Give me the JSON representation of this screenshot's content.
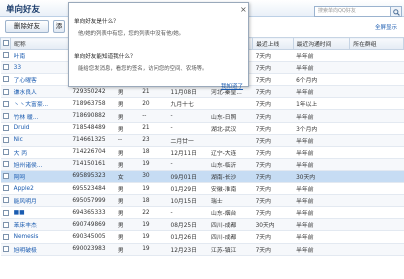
{
  "header": {
    "title": "单向好友",
    "search_placeholder": "搜索单向QQ好友",
    "search_icon": "magnifier"
  },
  "toolbar": {
    "delete_label": "删除好友",
    "filter_label": "添",
    "select_all": "全屏显示"
  },
  "popup": {
    "q1": "单向好友是什么？",
    "a1": "他/她的列表中有您，您的列表中没有他/她。",
    "q2": "单向好友能知道我什么？",
    "a2": "能给您发消息，看您的签名，访问您的空间、农场等。",
    "got_it": "我知道了"
  },
  "table": {
    "columns": [
      "昵称",
      "",
      "",
      "",
      "",
      "",
      "",
      "最近上线",
      "最近沟通时间",
      "所在群组"
    ],
    "rows": [
      {
        "nick": "叶南",
        "qq": "",
        "sex": "",
        "age": "",
        "birthday": "",
        "location": "",
        "last_online": "7天内",
        "last_contact": "半年前",
        "group": "",
        "style": "normal"
      },
      {
        "nick": "33",
        "qq": "",
        "sex": "",
        "age": "",
        "birthday": "",
        "location": "",
        "last_online": "7天内",
        "last_contact": "半年前",
        "group": "",
        "style": "alt"
      },
      {
        "nick": "了心曜客",
        "qq": "",
        "sex": "",
        "age": "",
        "birthday": "",
        "location": "",
        "last_online": "7天内",
        "last_contact": "6个月内",
        "group": "",
        "style": "normal"
      },
      {
        "nick": "谦水良人",
        "qq": "729350242",
        "sex": "男",
        "age": "21",
        "birthday": "11月08日",
        "location": "河北-秦皇...",
        "last_online": "7天内",
        "last_contact": "半年前",
        "group": "",
        "style": "alt"
      },
      {
        "nick": "丶丶大富豪...",
        "qq": "718963758",
        "sex": "男",
        "age": "20",
        "birthday": "九月十七",
        "location": "",
        "last_online": "7天内",
        "last_contact": "1年以上",
        "group": "",
        "style": "normal"
      },
      {
        "nick": "竹林 暖...",
        "qq": "718690882",
        "sex": "男",
        "age": "--",
        "birthday": "-",
        "location": "山东-日照",
        "last_online": "7天内",
        "last_contact": "半年前",
        "group": "",
        "style": "alt"
      },
      {
        "nick": "Druid",
        "qq": "718548489",
        "sex": "男",
        "age": "21",
        "birthday": "-",
        "location": "湖北-武汉",
        "last_online": "7天内",
        "last_contact": "3个月内",
        "group": "",
        "style": "normal"
      },
      {
        "nick": "Nic",
        "qq": "714661325",
        "sex": "--",
        "age": "23",
        "birthday": "二月廿一",
        "location": "",
        "last_online": "7天内",
        "last_contact": "半年前",
        "group": "",
        "style": "alt"
      },
      {
        "nick": "大 丙",
        "qq": "714226704",
        "sex": "男",
        "age": "18",
        "birthday": "12月11日",
        "location": "辽宁-大连",
        "last_online": "7天内",
        "last_contact": "半年前",
        "group": "",
        "style": "normal"
      },
      {
        "nick": "旭州诸侯...",
        "qq": "714150161",
        "sex": "男",
        "age": "19",
        "birthday": "-",
        "location": "山东-临沂",
        "last_online": "7天内",
        "last_contact": "半年前",
        "group": "",
        "style": "alt"
      },
      {
        "nick": "阿呵",
        "qq": "695895323",
        "sex": "女",
        "age": "30",
        "birthday": "09月01日",
        "location": "湖南-长沙",
        "last_online": "7天内",
        "last_contact": "30天内",
        "group": "",
        "style": "selected"
      },
      {
        "nick": "Apple2",
        "qq": "695523484",
        "sex": "男",
        "age": "19",
        "birthday": "01月29日",
        "location": "安徽-淮南",
        "last_online": "7天内",
        "last_contact": "半年前",
        "group": "",
        "style": "normal"
      },
      {
        "nick": "能风明月",
        "qq": "695057999",
        "sex": "男",
        "age": "18",
        "birthday": "10月15日",
        "location": "瑞士",
        "last_online": "7天内",
        "last_contact": "半年前",
        "group": "",
        "style": "alt"
      },
      {
        "nick": "■■",
        "qq": "694365333",
        "sex": "男",
        "age": "22",
        "birthday": "-",
        "location": "山东-烟台",
        "last_online": "7天内",
        "last_contact": "半年前",
        "group": "",
        "style": "normal"
      },
      {
        "nick": "苯床丰杰",
        "qq": "690749869",
        "sex": "男",
        "age": "19",
        "birthday": "08月25日",
        "location": "四川-成都",
        "last_online": "30天内",
        "last_contact": "半年前",
        "group": "",
        "style": "alt"
      },
      {
        "nick": "Nemesis",
        "qq": "690345005",
        "sex": "男",
        "age": "19",
        "birthday": "01月26日",
        "location": "四川-成都",
        "last_online": "7天内",
        "last_contact": "半年前",
        "group": "",
        "style": "normal"
      },
      {
        "nick": "旭明破极",
        "qq": "690023983",
        "sex": "男",
        "age": "19",
        "birthday": "12月23日",
        "location": "江苏-镇江",
        "last_online": "7天内",
        "last_contact": "半年前",
        "group": "",
        "style": "alt"
      }
    ]
  }
}
